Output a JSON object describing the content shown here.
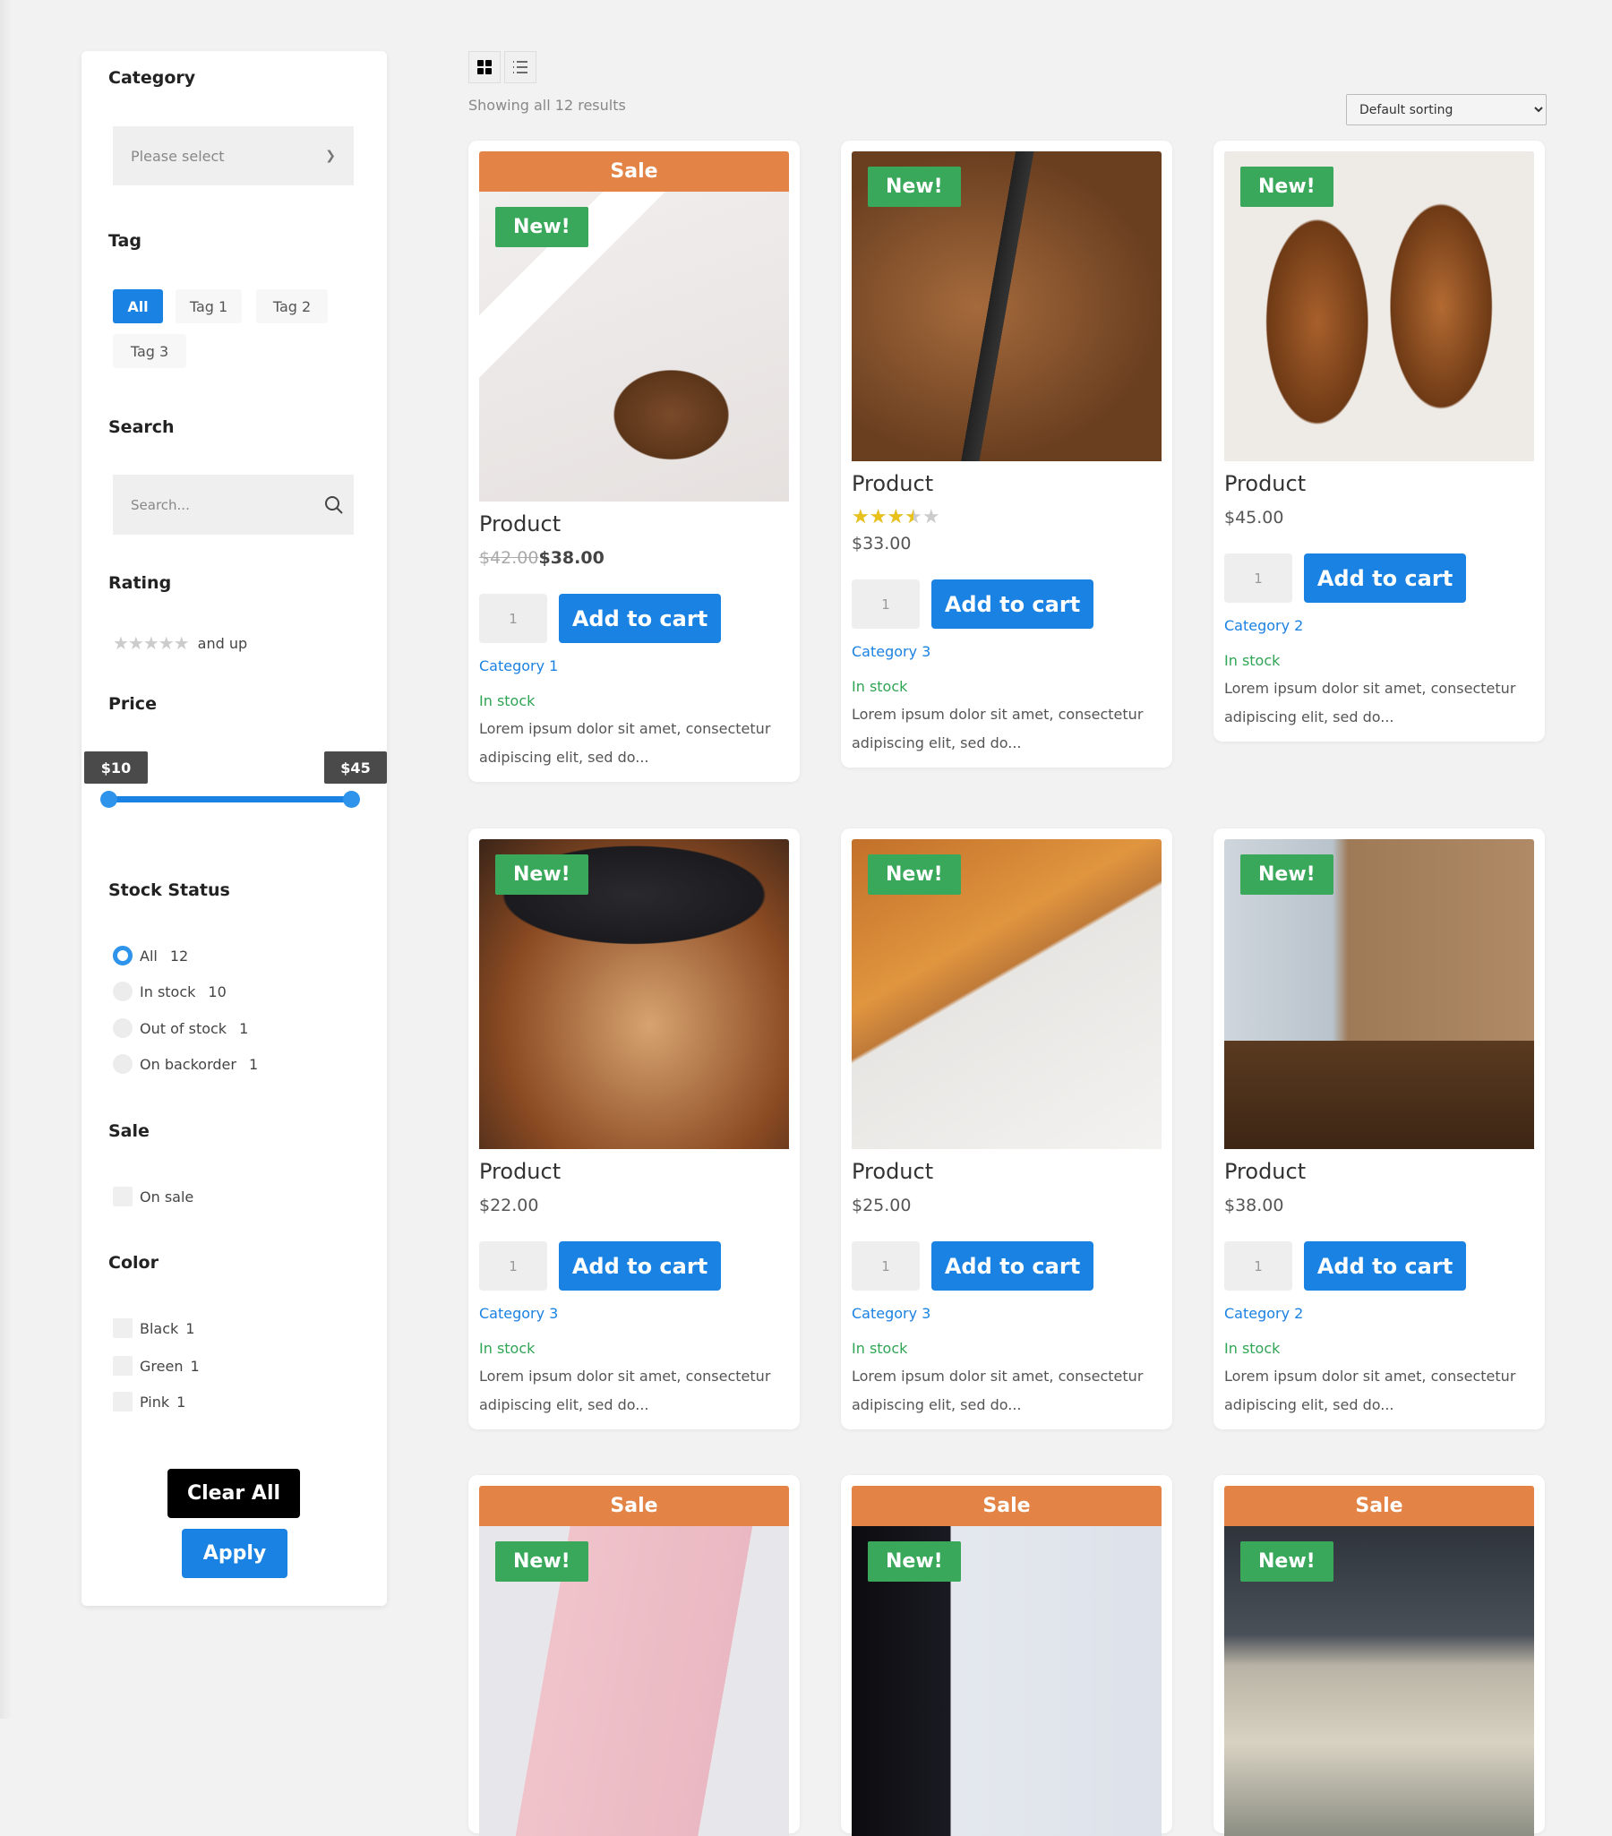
{
  "sidebar": {
    "category": {
      "heading": "Category",
      "placeholder": "Please select"
    },
    "tag": {
      "heading": "Tag",
      "items": [
        "All",
        "Tag 1",
        "Tag 2",
        "Tag 3"
      ],
      "active": "All"
    },
    "search": {
      "heading": "Search",
      "placeholder": "Search..."
    },
    "rating": {
      "heading": "Rating",
      "stars": "★★★★★",
      "suffix": "and up"
    },
    "price": {
      "heading": "Price",
      "min_label": "$10",
      "max_label": "$45",
      "min": 10,
      "max": 45
    },
    "stock": {
      "heading": "Stock Status",
      "options": [
        {
          "label": "All",
          "count": "12",
          "selected": true
        },
        {
          "label": "In stock",
          "count": "10"
        },
        {
          "label": "Out of stock",
          "count": "1"
        },
        {
          "label": "On backorder",
          "count": "1"
        }
      ]
    },
    "sale": {
      "heading": "Sale",
      "option": "On sale"
    },
    "color": {
      "heading": "Color",
      "options": [
        {
          "label": "Black",
          "count": "1"
        },
        {
          "label": "Green",
          "count": "1"
        },
        {
          "label": "Pink",
          "count": "1"
        }
      ]
    },
    "clear_label": "Clear All",
    "apply_label": "Apply"
  },
  "toolbar": {
    "grid_icon": "grid-icon",
    "list_icon": "list-icon",
    "results": "Showing all 12 results",
    "sorting": "Default sorting"
  },
  "labels": {
    "sale": "Sale",
    "new": "New!",
    "add_to_cart": "Add to cart",
    "qty": "1",
    "in_stock": "In stock"
  },
  "colors": {
    "accent": "#1a82e2",
    "sale": "#e38446",
    "new": "#3aa85b",
    "stock": "#2fa454"
  },
  "products": [
    {
      "title": "Product",
      "sale": true,
      "old_price": "$42.00",
      "price": "$38.00",
      "category": "Category 1",
      "desc": "Lorem ipsum dolor sit amet, consectetur adipiscing elit, sed do...",
      "image": "camera-photos"
    },
    {
      "title": "Product",
      "rating": 3.5,
      "price": "$33.00",
      "category": "Category 3",
      "desc": "Lorem ipsum dolor sit amet, consectetur adipiscing elit, sed do...",
      "image": "leather-bag"
    },
    {
      "title": "Product",
      "price": "$45.00",
      "category": "Category 2",
      "desc": "Lorem ipsum dolor sit amet, consectetur adipiscing elit, sed do...",
      "image": "leather-shoes"
    },
    {
      "title": "Product",
      "price": "$22.00",
      "category": "Category 3",
      "desc": "Lorem ipsum dolor sit amet, consectetur adipiscing elit, sed do...",
      "image": "woman-hat"
    },
    {
      "title": "Product",
      "price": "$25.00",
      "category": "Category 3",
      "desc": "Lorem ipsum dolor sit amet, consectetur adipiscing elit, sed do...",
      "image": "leather-closeup"
    },
    {
      "title": "Product",
      "price": "$38.00",
      "category": "Category 2",
      "desc": "Lorem ipsum dolor sit amet, consectetur adipiscing elit, sed do...",
      "image": "bedside-lamp"
    },
    {
      "sale": true,
      "image": "pink-notebook"
    },
    {
      "sale": true,
      "image": "desk-lamp"
    },
    {
      "sale": true,
      "image": "laptop-desk"
    }
  ]
}
